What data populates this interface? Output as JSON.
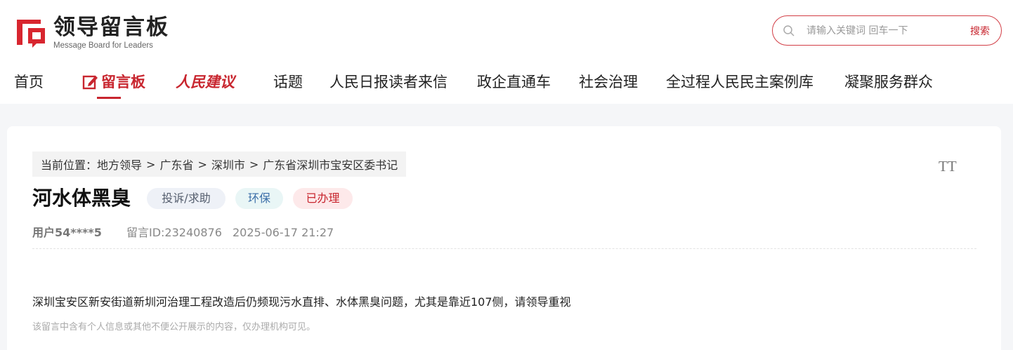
{
  "brand": {
    "title": "领导留言板",
    "subtitle": "Message Board for Leaders",
    "accent": "#c8262f"
  },
  "search": {
    "placeholder": "请输入关键词 回车一下",
    "button": "搜索"
  },
  "nav": {
    "items": [
      "首页",
      "留言板",
      "人民建议",
      "话题",
      "人民日报读者来信",
      "政企直通车",
      "社会治理",
      "全过程人民民主案例库",
      "凝聚服务群众"
    ],
    "active": "留言板"
  },
  "breadcrumb": {
    "prefix": "当前位置：",
    "items": [
      "地方领导",
      "广东省",
      "深圳市",
      "广东省深圳市宝安区委书记"
    ],
    "separator": ">"
  },
  "font_size_toggle": "TT",
  "message": {
    "title": "河水体黑臭",
    "tags": [
      {
        "label": "投诉/求助",
        "bg": "#eef1f7",
        "color": "#555e6e"
      },
      {
        "label": "环保",
        "bg": "#e9f6f6",
        "color": "#3b6ea8"
      },
      {
        "label": "已办理",
        "bg": "#fde9ea",
        "color": "#c8262f"
      }
    ],
    "user": "用户54****5",
    "message_id": "留言ID:23240876",
    "datetime": "2025-06-17 21:27",
    "content": "深圳宝安区新安街道新圳河治理工程改造后仍频现污水直排、水体黑臭问题，尤其是靠近107侧，请领导重视",
    "notice": "该留言中含有个人信息或其他不便公开展示的内容，仅办理机构可见。"
  }
}
